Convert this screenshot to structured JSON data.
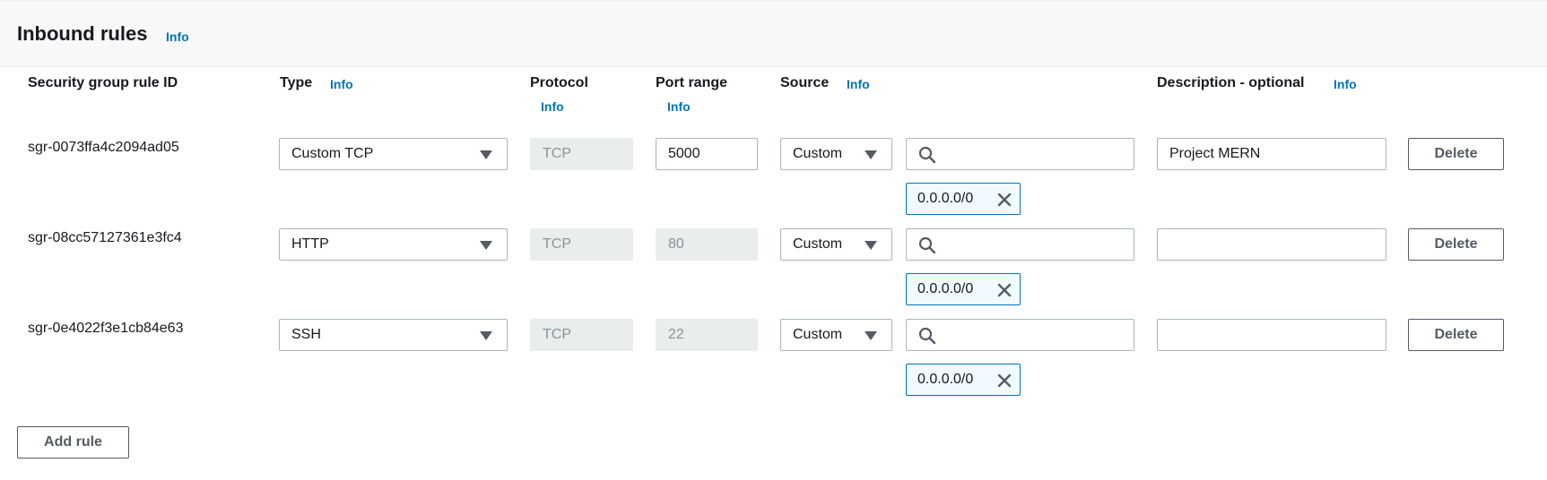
{
  "panel": {
    "title": "Inbound rules",
    "info": "Info"
  },
  "columns": {
    "rule_id": "Security group rule ID",
    "type": "Type",
    "type_info": "Info",
    "protocol": "Protocol",
    "protocol_info": "Info",
    "port_range": "Port range",
    "port_range_info": "Info",
    "source": "Source",
    "source_info": "Info",
    "description": "Description - optional",
    "description_info": "Info"
  },
  "rows": [
    {
      "rule_id": "sgr-0073ffa4c2094ad05",
      "type": "Custom TCP",
      "protocol": "TCP",
      "port": "5000",
      "port_editable": true,
      "source": "Custom",
      "search_value": "",
      "token": "0.0.0.0/0",
      "description": "Project MERN",
      "delete_label": "Delete"
    },
    {
      "rule_id": "sgr-08cc57127361e3fc4",
      "type": "HTTP",
      "protocol": "TCP",
      "port": "80",
      "port_editable": false,
      "source": "Custom",
      "search_value": "",
      "token": "0.0.0.0/0",
      "description": "",
      "delete_label": "Delete"
    },
    {
      "rule_id": "sgr-0e4022f3e1cb84e63",
      "type": "SSH",
      "protocol": "TCP",
      "port": "22",
      "port_editable": false,
      "source": "Custom",
      "search_value": "",
      "token": "0.0.0.0/0",
      "description": "",
      "delete_label": "Delete"
    }
  ],
  "actions": {
    "add_rule": "Add rule"
  },
  "icons": {
    "dropdown": "caret-down-icon",
    "search": "search-icon",
    "remove": "close-icon"
  },
  "colors": {
    "link": "#0073bb",
    "token_border": "#0073bb",
    "token_bg": "#f1faff",
    "disabled_bg": "#eaeded"
  }
}
